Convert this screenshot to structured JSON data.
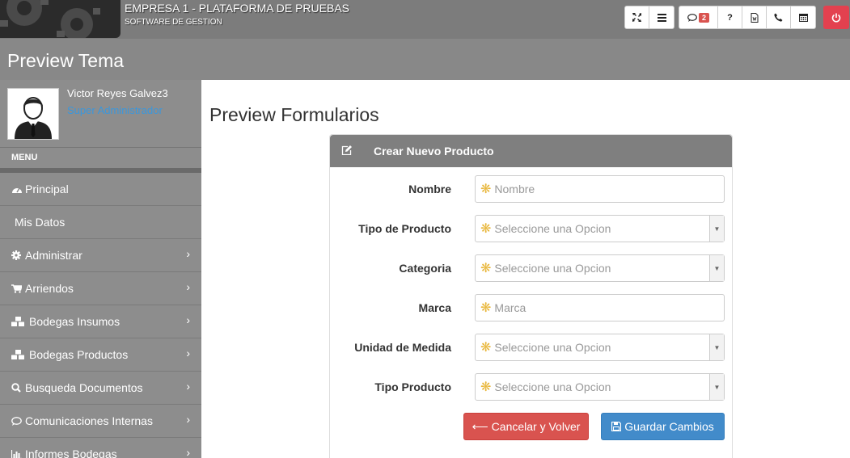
{
  "header": {
    "company": "EMPRESA 1 - PLATAFORMA DE PRUEBAS",
    "subtitle": "SOFTWARE DE GESTION",
    "notification_count": "2"
  },
  "band": {
    "title": "Preview Tema"
  },
  "user": {
    "name": "Victor Reyes Galvez3",
    "role": "Super Administrador"
  },
  "menu": {
    "heading": "MENU",
    "items": [
      {
        "label": "Principal",
        "icon": "dashboard-icon",
        "has_children": false
      },
      {
        "label": "Mis Datos",
        "icon": "",
        "has_children": false
      },
      {
        "label": "Administrar",
        "icon": "gear-icon",
        "has_children": true
      },
      {
        "label": "Arriendos",
        "icon": "cart-icon",
        "has_children": true
      },
      {
        "label": "Bodegas Insumos",
        "icon": "cubes-icon",
        "has_children": true
      },
      {
        "label": "Bodegas Productos",
        "icon": "cubes-icon",
        "has_children": true
      },
      {
        "label": "Busqueda Documentos",
        "icon": "search-icon",
        "has_children": true
      },
      {
        "label": "Comunicaciones Internas",
        "icon": "chat-icon",
        "has_children": true
      },
      {
        "label": "Informes Bodegas",
        "icon": "bar-chart-icon",
        "has_children": true
      }
    ]
  },
  "main": {
    "title": "Preview Formularios",
    "panel_title": "Crear Nuevo Producto",
    "fields": [
      {
        "label": "Nombre",
        "placeholder": "Nombre",
        "type": "text"
      },
      {
        "label": "Tipo de Producto",
        "placeholder": "Seleccione una Opcion",
        "type": "select"
      },
      {
        "label": "Categoria",
        "placeholder": "Seleccione una Opcion",
        "type": "select"
      },
      {
        "label": "Marca",
        "placeholder": "Marca",
        "type": "text"
      },
      {
        "label": "Unidad de Medida",
        "placeholder": "Seleccione una Opcion",
        "type": "select"
      },
      {
        "label": "Tipo Producto",
        "placeholder": "Seleccione una Opcion",
        "type": "select"
      }
    ],
    "cancel_label": "Cancelar y Volver",
    "save_label": "Guardar Cambios"
  },
  "colors": {
    "danger": "#d9534f",
    "primary": "#428bca",
    "power": "#e3414f",
    "link": "#3a97dd"
  }
}
